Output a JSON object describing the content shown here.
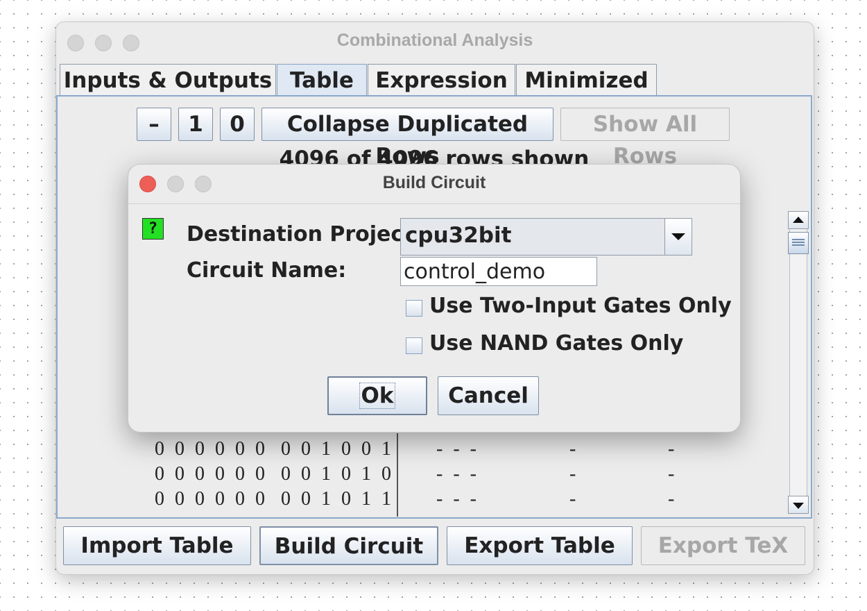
{
  "window": {
    "title": "Combinational Analysis"
  },
  "tabs": [
    {
      "label": "Inputs & Outputs",
      "active": false
    },
    {
      "label": "Table",
      "active": true
    },
    {
      "label": "Expression",
      "active": false
    },
    {
      "label": "Minimized",
      "active": false
    }
  ],
  "table_toolbar": {
    "minus_label": "–",
    "one_label": "1",
    "zero_label": "0",
    "collapse_label": "Collapse Duplicated Rows",
    "show_all_label": "Show All Rows",
    "show_all_enabled": false
  },
  "rows_shown": "4096 of 4096 rows shown",
  "table_rows": [
    {
      "a": "0 0 0 0 0 0",
      "b": "0 0 1 0 0 1",
      "c": "- - -",
      "d": "-",
      "e": "-"
    },
    {
      "a": "0 0 0 0 0 0",
      "b": "0 0 1 0 1 0",
      "c": "- - -",
      "d": "-",
      "e": "-"
    },
    {
      "a": "0 0 0 0 0 0",
      "b": "0 0 1 0 1 1",
      "c": "- - -",
      "d": "-",
      "e": "-"
    }
  ],
  "bottom_buttons": {
    "import": "Import Table",
    "build": "Build Circuit",
    "export": "Export Table",
    "export_tex": "Export TeX",
    "export_tex_enabled": false
  },
  "dialog": {
    "title": "Build Circuit",
    "help_icon_glyph": "?",
    "destination_label": "Destination Project:",
    "destination_value": "cpu32bit",
    "circuit_name_label": "Circuit Name:",
    "circuit_name_value": "control_demo",
    "two_input_label": "Use Two-Input Gates Only",
    "two_input_checked": false,
    "nand_label": "Use NAND Gates Only",
    "nand_checked": false,
    "ok_label": "Ok",
    "cancel_label": "Cancel"
  },
  "colors": {
    "close_button": "#ee5f58",
    "help_icon": "#22e022",
    "accent_border": "#8aa8cc"
  },
  "icons": {
    "help": "question-mark-icon",
    "combo_arrow": "chevron-down-icon",
    "scroll_up": "arrow-up-icon",
    "scroll_down": "arrow-down-icon"
  }
}
